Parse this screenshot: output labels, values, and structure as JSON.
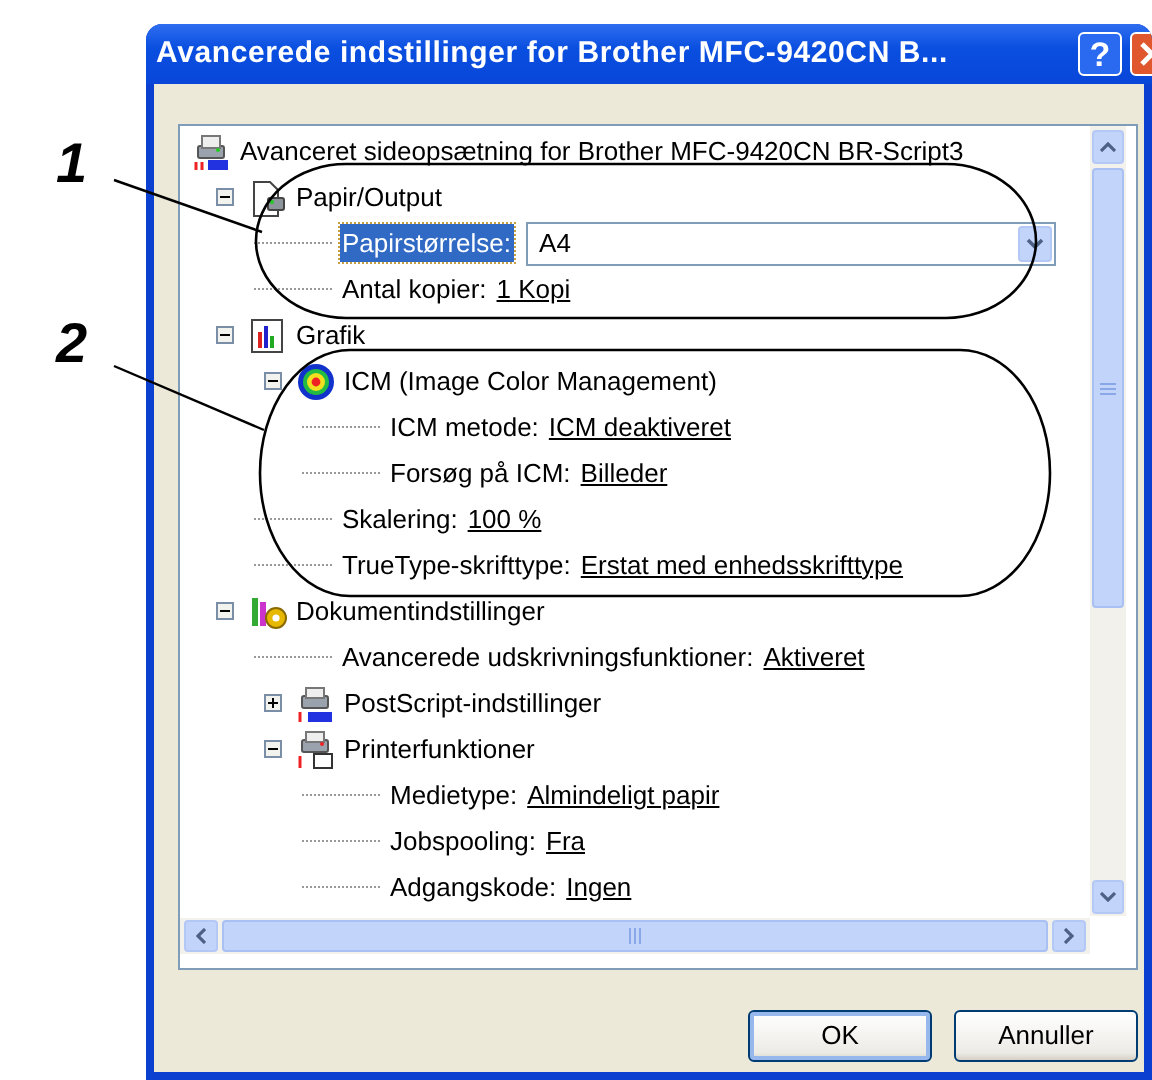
{
  "callouts": [
    {
      "label": "1"
    },
    {
      "label": "2"
    }
  ],
  "window": {
    "title": "Avancerede indstillinger for Brother MFC-9420CN B...",
    "help_button": "?"
  },
  "tree": [
    {
      "kind": "printer",
      "label": "Avanceret sideopsætning for Brother MFC-9420CN BR-Script3",
      "children": [
        {
          "kind": "paper",
          "label": "Papir/Output",
          "expanded": true,
          "children": [
            {
              "kind": "dropdown",
              "label": "Papirstørrelse:",
              "value": "A4",
              "selected": true
            },
            {
              "kind": "setting",
              "label": "Antal kopier:",
              "value": "1 Kopi",
              "selected": false
            }
          ]
        },
        {
          "kind": "graphics",
          "label": "Grafik",
          "expanded": true,
          "children": [
            {
              "kind": "color",
              "label": "ICM (Image Color Management)",
              "expanded": true,
              "children": [
                {
                  "kind": "setting",
                  "label": "ICM metode:",
                  "value": "ICM deaktiveret",
                  "selected": false
                },
                {
                  "kind": "setting",
                  "label": "Forsøg på ICM:",
                  "value": "Billeder",
                  "selected": false
                }
              ]
            },
            {
              "kind": "setting",
              "label": "Skalering:",
              "value": "100 %",
              "selected": false
            },
            {
              "kind": "setting",
              "label": "TrueType-skrifttype:",
              "value": "Erstat med enhedsskrifttype",
              "selected": false
            }
          ]
        },
        {
          "kind": "settings",
          "label": "Dokumentindstillinger",
          "expanded": true,
          "children": [
            {
              "kind": "setting",
              "label": "Avancerede udskrivningsfunktioner:",
              "value": "Aktiveret",
              "selected": false
            },
            {
              "kind": "postscript",
              "label": "PostScript-indstillinger",
              "expanded": false
            },
            {
              "kind": "features",
              "label": "Printerfunktioner",
              "expanded": true,
              "children": [
                {
                  "kind": "setting",
                  "label": "Medietype:",
                  "value": "Almindeligt papir",
                  "selected": false
                },
                {
                  "kind": "setting",
                  "label": "Jobspooling:",
                  "value": "Fra",
                  "selected": false
                },
                {
                  "kind": "setting",
                  "label": "Adgangskode:",
                  "value": "Ingen",
                  "selected": false
                }
              ]
            }
          ]
        }
      ]
    }
  ],
  "buttons": [
    {
      "label": "OK",
      "default": true
    },
    {
      "label": "Annuller",
      "default": false
    }
  ]
}
